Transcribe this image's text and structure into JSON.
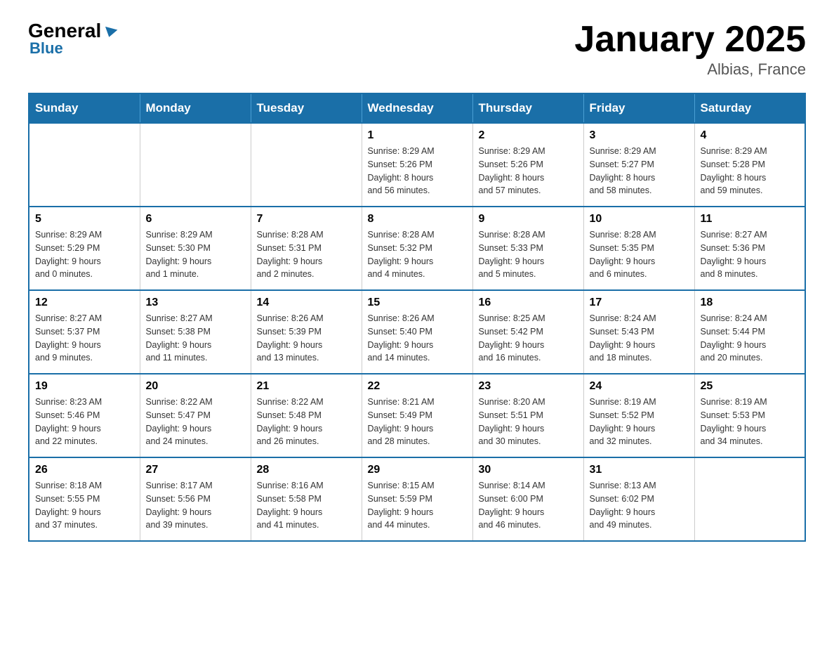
{
  "logo": {
    "general": "General",
    "blue": "Blue",
    "triangle": "▲"
  },
  "header": {
    "title": "January 2025",
    "location": "Albias, France"
  },
  "weekdays": [
    "Sunday",
    "Monday",
    "Tuesday",
    "Wednesday",
    "Thursday",
    "Friday",
    "Saturday"
  ],
  "weeks": [
    [
      {
        "day": "",
        "info": ""
      },
      {
        "day": "",
        "info": ""
      },
      {
        "day": "",
        "info": ""
      },
      {
        "day": "1",
        "info": "Sunrise: 8:29 AM\nSunset: 5:26 PM\nDaylight: 8 hours\nand 56 minutes."
      },
      {
        "day": "2",
        "info": "Sunrise: 8:29 AM\nSunset: 5:26 PM\nDaylight: 8 hours\nand 57 minutes."
      },
      {
        "day": "3",
        "info": "Sunrise: 8:29 AM\nSunset: 5:27 PM\nDaylight: 8 hours\nand 58 minutes."
      },
      {
        "day": "4",
        "info": "Sunrise: 8:29 AM\nSunset: 5:28 PM\nDaylight: 8 hours\nand 59 minutes."
      }
    ],
    [
      {
        "day": "5",
        "info": "Sunrise: 8:29 AM\nSunset: 5:29 PM\nDaylight: 9 hours\nand 0 minutes."
      },
      {
        "day": "6",
        "info": "Sunrise: 8:29 AM\nSunset: 5:30 PM\nDaylight: 9 hours\nand 1 minute."
      },
      {
        "day": "7",
        "info": "Sunrise: 8:28 AM\nSunset: 5:31 PM\nDaylight: 9 hours\nand 2 minutes."
      },
      {
        "day": "8",
        "info": "Sunrise: 8:28 AM\nSunset: 5:32 PM\nDaylight: 9 hours\nand 4 minutes."
      },
      {
        "day": "9",
        "info": "Sunrise: 8:28 AM\nSunset: 5:33 PM\nDaylight: 9 hours\nand 5 minutes."
      },
      {
        "day": "10",
        "info": "Sunrise: 8:28 AM\nSunset: 5:35 PM\nDaylight: 9 hours\nand 6 minutes."
      },
      {
        "day": "11",
        "info": "Sunrise: 8:27 AM\nSunset: 5:36 PM\nDaylight: 9 hours\nand 8 minutes."
      }
    ],
    [
      {
        "day": "12",
        "info": "Sunrise: 8:27 AM\nSunset: 5:37 PM\nDaylight: 9 hours\nand 9 minutes."
      },
      {
        "day": "13",
        "info": "Sunrise: 8:27 AM\nSunset: 5:38 PM\nDaylight: 9 hours\nand 11 minutes."
      },
      {
        "day": "14",
        "info": "Sunrise: 8:26 AM\nSunset: 5:39 PM\nDaylight: 9 hours\nand 13 minutes."
      },
      {
        "day": "15",
        "info": "Sunrise: 8:26 AM\nSunset: 5:40 PM\nDaylight: 9 hours\nand 14 minutes."
      },
      {
        "day": "16",
        "info": "Sunrise: 8:25 AM\nSunset: 5:42 PM\nDaylight: 9 hours\nand 16 minutes."
      },
      {
        "day": "17",
        "info": "Sunrise: 8:24 AM\nSunset: 5:43 PM\nDaylight: 9 hours\nand 18 minutes."
      },
      {
        "day": "18",
        "info": "Sunrise: 8:24 AM\nSunset: 5:44 PM\nDaylight: 9 hours\nand 20 minutes."
      }
    ],
    [
      {
        "day": "19",
        "info": "Sunrise: 8:23 AM\nSunset: 5:46 PM\nDaylight: 9 hours\nand 22 minutes."
      },
      {
        "day": "20",
        "info": "Sunrise: 8:22 AM\nSunset: 5:47 PM\nDaylight: 9 hours\nand 24 minutes."
      },
      {
        "day": "21",
        "info": "Sunrise: 8:22 AM\nSunset: 5:48 PM\nDaylight: 9 hours\nand 26 minutes."
      },
      {
        "day": "22",
        "info": "Sunrise: 8:21 AM\nSunset: 5:49 PM\nDaylight: 9 hours\nand 28 minutes."
      },
      {
        "day": "23",
        "info": "Sunrise: 8:20 AM\nSunset: 5:51 PM\nDaylight: 9 hours\nand 30 minutes."
      },
      {
        "day": "24",
        "info": "Sunrise: 8:19 AM\nSunset: 5:52 PM\nDaylight: 9 hours\nand 32 minutes."
      },
      {
        "day": "25",
        "info": "Sunrise: 8:19 AM\nSunset: 5:53 PM\nDaylight: 9 hours\nand 34 minutes."
      }
    ],
    [
      {
        "day": "26",
        "info": "Sunrise: 8:18 AM\nSunset: 5:55 PM\nDaylight: 9 hours\nand 37 minutes."
      },
      {
        "day": "27",
        "info": "Sunrise: 8:17 AM\nSunset: 5:56 PM\nDaylight: 9 hours\nand 39 minutes."
      },
      {
        "day": "28",
        "info": "Sunrise: 8:16 AM\nSunset: 5:58 PM\nDaylight: 9 hours\nand 41 minutes."
      },
      {
        "day": "29",
        "info": "Sunrise: 8:15 AM\nSunset: 5:59 PM\nDaylight: 9 hours\nand 44 minutes."
      },
      {
        "day": "30",
        "info": "Sunrise: 8:14 AM\nSunset: 6:00 PM\nDaylight: 9 hours\nand 46 minutes."
      },
      {
        "day": "31",
        "info": "Sunrise: 8:13 AM\nSunset: 6:02 PM\nDaylight: 9 hours\nand 49 minutes."
      },
      {
        "day": "",
        "info": ""
      }
    ]
  ]
}
